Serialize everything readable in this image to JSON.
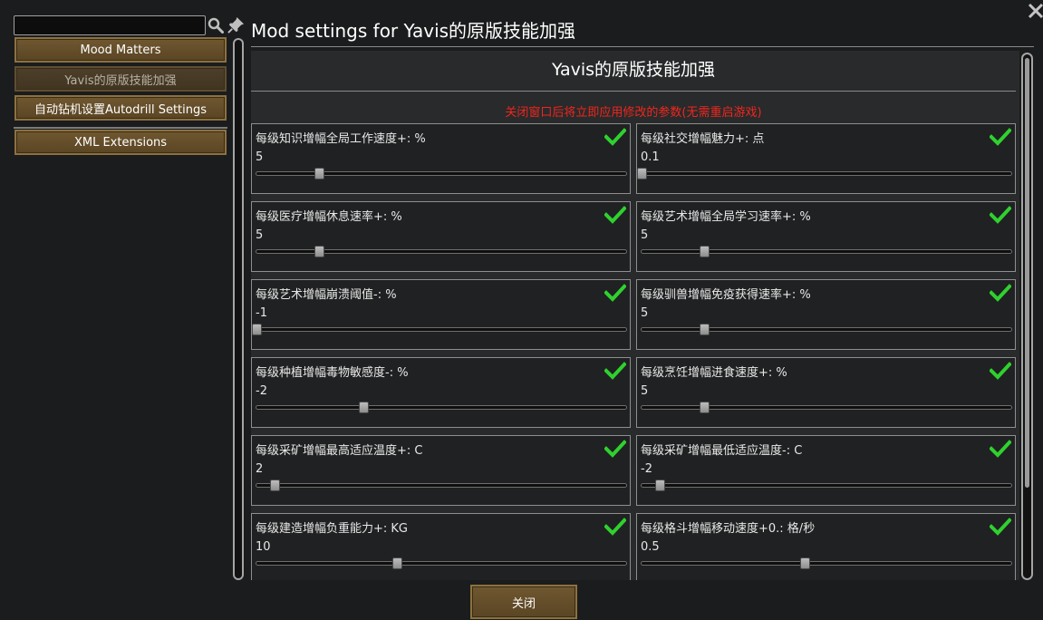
{
  "colors": {
    "background": "#1b1c1d",
    "panel": "#292a2b",
    "button": "#6f5730",
    "button_selected": "#4d3f2a",
    "notice": "#f0261e",
    "check": "#2fd12f"
  },
  "sidebar": {
    "search": {
      "value": "",
      "placeholder": ""
    },
    "icons": [
      "search-icon",
      "pin-icon"
    ],
    "mods": [
      {
        "label": "Mood Matters",
        "selected": false
      },
      {
        "label": "Yavis的原版技能加强",
        "selected": true
      },
      {
        "label": "自动钻机设置Autodrill Settings",
        "selected": false
      },
      {
        "label": "XML Extensions",
        "selected": false
      }
    ]
  },
  "window": {
    "title": "Mod settings for Yavis的原版技能加强"
  },
  "settings": {
    "heading": "Yavis的原版技能加强",
    "notice": "关闭窗口后将立即应用修改的参数(无需重启游戏)",
    "items": [
      {
        "label": "每级知识增幅全局工作速度+: %",
        "value": "5",
        "slider": 0.17,
        "enabled": true
      },
      {
        "label": "每级社交增幅魅力+: 点",
        "value": "0.1",
        "slider": 0.0,
        "enabled": true
      },
      {
        "label": "每级医疗增幅休息速率+: %",
        "value": "5",
        "slider": 0.17,
        "enabled": true
      },
      {
        "label": "每级艺术增幅全局学习速率+: %",
        "value": "5",
        "slider": 0.17,
        "enabled": true
      },
      {
        "label": "每级艺术增幅崩溃阈值-: %",
        "value": "-1",
        "slider": 0.0,
        "enabled": true
      },
      {
        "label": "每级驯兽增幅免疫获得速率+: %",
        "value": "5",
        "slider": 0.17,
        "enabled": true
      },
      {
        "label": "每级种植增幅毒物敏感度-: %",
        "value": "-2",
        "slider": 0.29,
        "enabled": true
      },
      {
        "label": "每级烹饪增幅进食速度+: %",
        "value": "5",
        "slider": 0.17,
        "enabled": true
      },
      {
        "label": "每级采矿增幅最高适应温度+: C",
        "value": "2",
        "slider": 0.05,
        "enabled": true
      },
      {
        "label": "每级采矿增幅最低适应温度-: C",
        "value": "-2",
        "slider": 0.05,
        "enabled": true
      },
      {
        "label": "每级建造增幅负重能力+: KG",
        "value": "10",
        "slider": 0.38,
        "enabled": true
      },
      {
        "label": "每级格斗增幅移动速度+0.: 格/秒",
        "value": "0.5",
        "slider": 0.44,
        "enabled": true
      }
    ]
  },
  "footer": {
    "close_label": "关闭"
  }
}
